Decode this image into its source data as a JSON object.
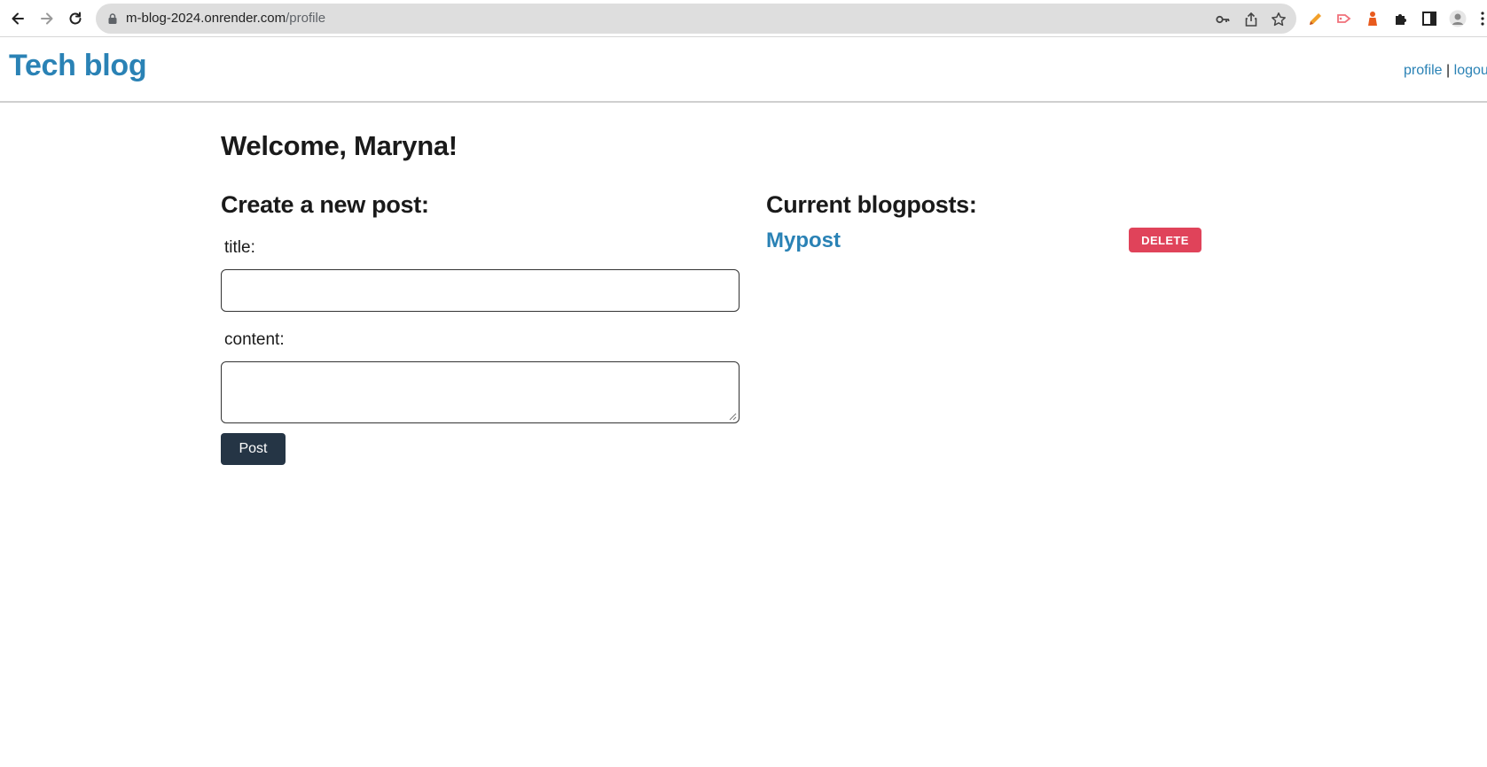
{
  "browser": {
    "url_host": "m-blog-2024.onrender.com",
    "url_path": "/profile",
    "icons": [
      "back-icon",
      "forward-icon",
      "reload-icon",
      "lock-icon",
      "key-icon",
      "share-icon",
      "star-icon",
      "pencil-extension-icon",
      "arrow-extension-icon",
      "figure-extension-icon",
      "puzzle-extension-icon",
      "sidebar-icon",
      "avatar",
      "menu-icon"
    ]
  },
  "header": {
    "brand": "Tech blog",
    "links": {
      "profile": "profile",
      "separator": "|",
      "logout": "logou"
    }
  },
  "main": {
    "welcome": "Welcome, Maryna!",
    "create": {
      "heading": "Create a new post:",
      "title_label": "title:",
      "title_value": "",
      "content_label": "content:",
      "content_value": "",
      "submit_label": "Post"
    },
    "current": {
      "heading": "Current blogposts:",
      "posts": [
        {
          "title": "Mypost",
          "delete_label": "DELETE"
        }
      ]
    }
  },
  "colors": {
    "brand": "#2a82b5",
    "post_button": "#253545",
    "delete_button": "#e0435a"
  }
}
